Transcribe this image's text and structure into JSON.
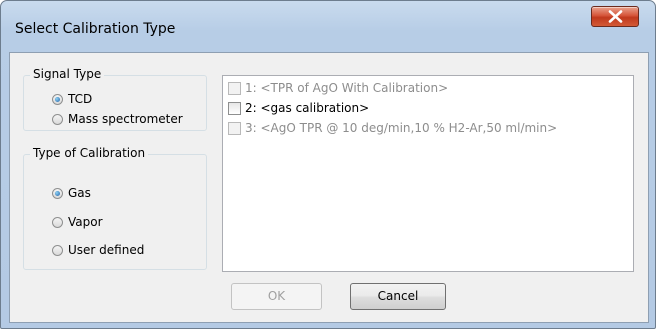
{
  "window": {
    "title": "Select Calibration Type",
    "close_icon": "close-x-icon"
  },
  "signal_type": {
    "title": "Signal Type",
    "options": [
      {
        "label": "TCD",
        "checked": true
      },
      {
        "label": "Mass spectrometer",
        "checked": false
      }
    ]
  },
  "calibration_type": {
    "title": "Type of Calibration",
    "options": [
      {
        "label": "Gas",
        "checked": true
      },
      {
        "label": "Vapor",
        "checked": false
      },
      {
        "label": "User defined",
        "checked": false
      }
    ]
  },
  "calibrations": [
    {
      "label": "1: <TPR of AgO With Calibration>",
      "checked": false,
      "enabled": false
    },
    {
      "label": "2: <gas calibration>",
      "checked": false,
      "enabled": true
    },
    {
      "label": "3: <AgO TPR @ 10 deg/min,10 % H2-Ar,50 ml/min>",
      "checked": false,
      "enabled": false
    }
  ],
  "buttons": {
    "ok": "OK",
    "cancel": "Cancel",
    "ok_enabled": false
  },
  "colors": {
    "close_button": "#c9432a",
    "title_bar": "#b9cfe7",
    "client_background": "#f0f0f0",
    "disabled_text": "#8d8d8d"
  }
}
